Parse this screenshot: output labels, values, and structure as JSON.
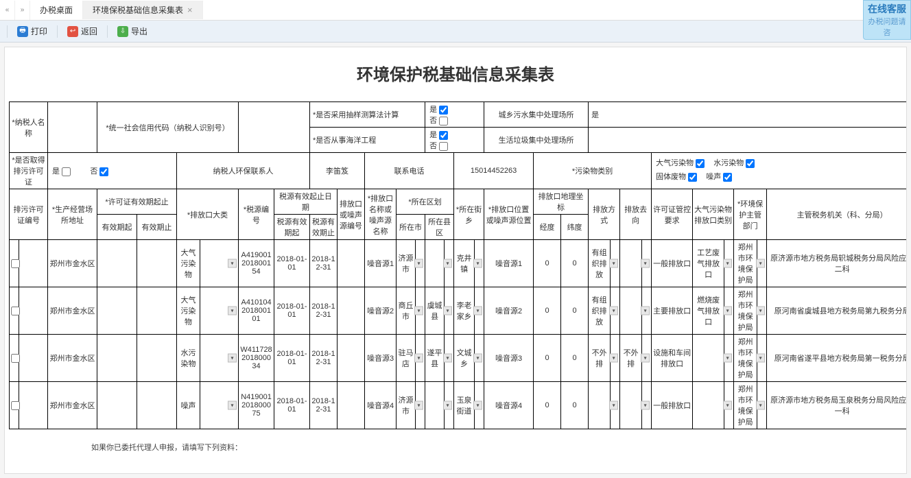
{
  "tabs": {
    "prev_glyph": "«",
    "next_glyph": "»",
    "items": [
      {
        "label": "办税桌面",
        "closable": false
      },
      {
        "label": "环境保税基础信息采集表",
        "closable": true
      }
    ]
  },
  "toolbar": {
    "print": "打印",
    "back": "返回",
    "export": "导出"
  },
  "help_float": {
    "line1": "在线客服",
    "line2": "办税问题请咨"
  },
  "title": "环境保护税基础信息采集表",
  "header_block": {
    "taxpayer_name_label": "*纳税人名称",
    "taxpayer_name_value": "",
    "credit_code_label": "*统一社会信用代码（纳税人识别号）",
    "credit_code_value": "",
    "sampling_label": "*是否采用抽样测算法计算",
    "marine_label": "*是否从事海洋工程",
    "yes_label": "是",
    "no_label": "否",
    "sewage_plant_label": "城乡污水集中处理场所",
    "sewage_plant_value": "是",
    "garbage_plant_label": "生活垃圾集中处理场所",
    "garbage_plant_value": "",
    "permit_obtained_label": "*是否取得排污许可证",
    "env_contact_label": "纳税人环保联系人",
    "env_contact_value": "李笛笈",
    "phone_label": "联系电话",
    "phone_value": "15014452263",
    "pollutant_cat_label": "*污染物类别",
    "pollutants": {
      "air": "大气污染物",
      "water": "水污染物",
      "solid": "固体废物",
      "noise": "噪声"
    }
  },
  "columns": {
    "permit_no": "排污许可证编号",
    "prod_addr": "*生产经营场所地址",
    "permit_period": "*许可证有效期起止",
    "valid_from": "有效期起",
    "valid_to": "有效期止",
    "outlet_major": "*排放口大类",
    "tax_src_no": "*税源编号",
    "tax_src_period": "税源有效起止日期",
    "tax_src_from": "税源有效期起",
    "tax_src_to": "税源有效期止",
    "outlet_noise_no": "排放口或噪声源编号",
    "outlet_noise_name": "*排放口名称或噪声源名称",
    "district": "*所在区划",
    "city": "所在市",
    "county": "所在县区",
    "town": "*所在街乡",
    "outlet_noise_pos": "*排放口位置或噪声源位置",
    "outlet_coord": "排放口地理坐标",
    "lng": "经度",
    "lat": "纬度",
    "emit_mode": "排放方式",
    "emit_dir": "排放去向",
    "permit_req": "许可证管控要求",
    "air_outlet_type": "大气污染物排放口类别",
    "env_dept": "*环境保护主管部门",
    "tax_office": "主管税务机关（科、分局）"
  },
  "rows": [
    {
      "permit_no": "",
      "addr": "郑州市金水区",
      "valid_from": "",
      "valid_to": "",
      "outlet_major": "大气污染物",
      "tax_src_no": "A419001201800154",
      "tax_src_from": "2018-01-01",
      "tax_src_to": "2018-12-31",
      "outlet_noise_no": "",
      "outlet_noise_name": "噪音源1",
      "city": "济源市",
      "county": "",
      "town": "克井镇",
      "outlet_noise_pos": "噪音源1",
      "lng": "0",
      "lat": "0",
      "emit_mode": "有组织排放",
      "emit_dir": "",
      "permit_req": "一般排放口",
      "air_outlet_type": "工艺废气排放口",
      "env_dept": "郑州市环境保护局",
      "tax_office": "原济源市地方税务局轵城税务分局风险应对二科"
    },
    {
      "permit_no": "",
      "addr": "郑州市金水区",
      "valid_from": "",
      "valid_to": "",
      "outlet_major": "大气污染物",
      "tax_src_no": "A410104201800101",
      "tax_src_from": "2018-01-01",
      "tax_src_to": "2018-12-31",
      "outlet_noise_no": "",
      "outlet_noise_name": "噪音源2",
      "city": "商丘市",
      "county": "虞城县",
      "town": "李老家乡",
      "outlet_noise_pos": "噪音源2",
      "lng": "0",
      "lat": "0",
      "emit_mode": "有组织排放",
      "emit_dir": "",
      "permit_req": "主要排放口",
      "air_outlet_type": "燃烧废气排放口",
      "env_dept": "郑州市环境保护局",
      "tax_office": "原河南省虞城县地方税务局第九税务分局"
    },
    {
      "permit_no": "",
      "addr": "郑州市金水区",
      "valid_from": "",
      "valid_to": "",
      "outlet_major": "水污染物",
      "tax_src_no": "W411728201800034",
      "tax_src_from": "2018-01-01",
      "tax_src_to": "2018-12-31",
      "outlet_noise_no": "",
      "outlet_noise_name": "噪音源3",
      "city": "驻马店",
      "county": "遂平县",
      "town": "文城乡",
      "outlet_noise_pos": "噪音源3",
      "lng": "0",
      "lat": "0",
      "emit_mode": "不外排",
      "emit_dir": "不外排",
      "permit_req": "设施和车间排放口",
      "air_outlet_type": "",
      "env_dept": "郑州市环境保护局",
      "tax_office": "原河南省遂平县地方税务局第一税务分局"
    },
    {
      "permit_no": "",
      "addr": "郑州市金水区",
      "valid_from": "",
      "valid_to": "",
      "outlet_major": "噪声",
      "tax_src_no": "N419001201800075",
      "tax_src_from": "2018-01-01",
      "tax_src_to": "2018-12-31",
      "outlet_noise_no": "",
      "outlet_noise_name": "噪音源4",
      "city": "济源市",
      "county": "",
      "town": "玉泉街道",
      "outlet_noise_pos": "噪音源4",
      "lng": "0",
      "lat": "0",
      "emit_mode": "",
      "emit_dir": "",
      "permit_req": "一般排放口",
      "air_outlet_type": "",
      "env_dept": "郑州市环境保护局",
      "tax_office": "原济源市地方税务局玉泉税务分局风险应对一科"
    }
  ],
  "footnote": "如果你已委托代理人申报，请填写下列资料："
}
